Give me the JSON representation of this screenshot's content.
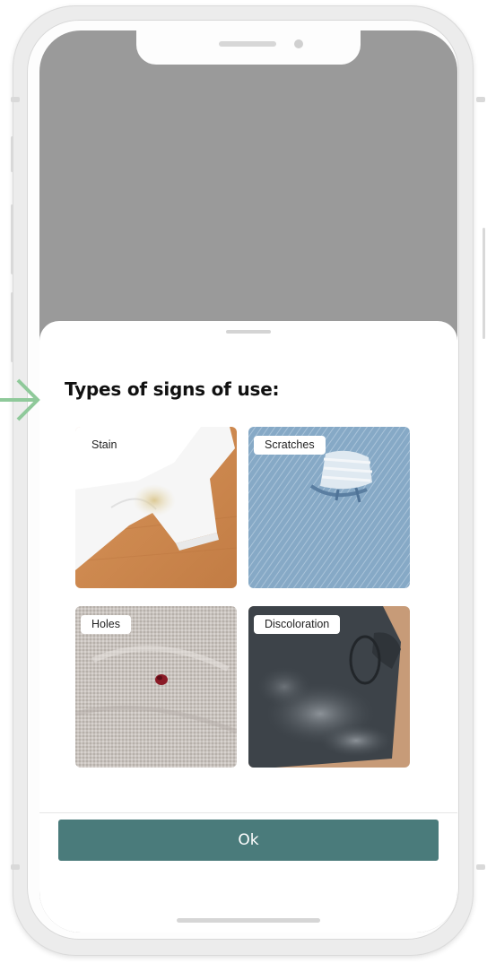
{
  "sheet": {
    "title": "Types of signs of use:",
    "items": [
      {
        "label": "Stain",
        "image": "white t-shirt with underarm stain"
      },
      {
        "label": "Scratches",
        "image": "denim with frayed tear"
      },
      {
        "label": "Holes",
        "image": "knit fabric with small hole"
      },
      {
        "label": "Discoloration",
        "image": "dark shirt with faded bleach marks"
      }
    ],
    "ok_label": "Ok"
  },
  "colors": {
    "primary_button": "#4a7b7b",
    "backdrop": "#9a9a9a",
    "annotation_arrow": "#8fc99a"
  },
  "icons": {
    "annotation": "arrow-right-icon"
  }
}
